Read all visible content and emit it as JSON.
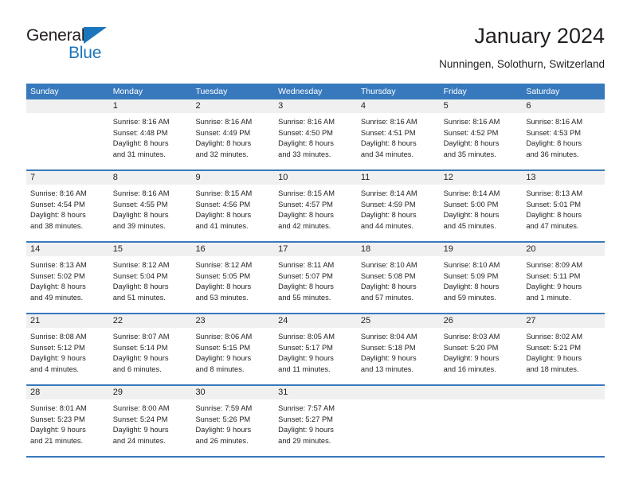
{
  "brand": {
    "name_part1": "General",
    "name_part2": "Blue",
    "triangle_color": "#1b75bb"
  },
  "header": {
    "title": "January 2024",
    "subtitle": "Nunningen, Solothurn, Switzerland"
  },
  "theme": {
    "header_blue": "#3879bd",
    "day_band_gray": "#f0f0f0",
    "text_color": "#231f20"
  },
  "weekdays": [
    "Sunday",
    "Monday",
    "Tuesday",
    "Wednesday",
    "Thursday",
    "Friday",
    "Saturday"
  ],
  "weeks": [
    [
      {
        "day": "",
        "lines": []
      },
      {
        "day": "1",
        "lines": [
          "Sunrise: 8:16 AM",
          "Sunset: 4:48 PM",
          "Daylight: 8 hours",
          "and 31 minutes."
        ]
      },
      {
        "day": "2",
        "lines": [
          "Sunrise: 8:16 AM",
          "Sunset: 4:49 PM",
          "Daylight: 8 hours",
          "and 32 minutes."
        ]
      },
      {
        "day": "3",
        "lines": [
          "Sunrise: 8:16 AM",
          "Sunset: 4:50 PM",
          "Daylight: 8 hours",
          "and 33 minutes."
        ]
      },
      {
        "day": "4",
        "lines": [
          "Sunrise: 8:16 AM",
          "Sunset: 4:51 PM",
          "Daylight: 8 hours",
          "and 34 minutes."
        ]
      },
      {
        "day": "5",
        "lines": [
          "Sunrise: 8:16 AM",
          "Sunset: 4:52 PM",
          "Daylight: 8 hours",
          "and 35 minutes."
        ]
      },
      {
        "day": "6",
        "lines": [
          "Sunrise: 8:16 AM",
          "Sunset: 4:53 PM",
          "Daylight: 8 hours",
          "and 36 minutes."
        ]
      }
    ],
    [
      {
        "day": "7",
        "lines": [
          "Sunrise: 8:16 AM",
          "Sunset: 4:54 PM",
          "Daylight: 8 hours",
          "and 38 minutes."
        ]
      },
      {
        "day": "8",
        "lines": [
          "Sunrise: 8:16 AM",
          "Sunset: 4:55 PM",
          "Daylight: 8 hours",
          "and 39 minutes."
        ]
      },
      {
        "day": "9",
        "lines": [
          "Sunrise: 8:15 AM",
          "Sunset: 4:56 PM",
          "Daylight: 8 hours",
          "and 41 minutes."
        ]
      },
      {
        "day": "10",
        "lines": [
          "Sunrise: 8:15 AM",
          "Sunset: 4:57 PM",
          "Daylight: 8 hours",
          "and 42 minutes."
        ]
      },
      {
        "day": "11",
        "lines": [
          "Sunrise: 8:14 AM",
          "Sunset: 4:59 PM",
          "Daylight: 8 hours",
          "and 44 minutes."
        ]
      },
      {
        "day": "12",
        "lines": [
          "Sunrise: 8:14 AM",
          "Sunset: 5:00 PM",
          "Daylight: 8 hours",
          "and 45 minutes."
        ]
      },
      {
        "day": "13",
        "lines": [
          "Sunrise: 8:13 AM",
          "Sunset: 5:01 PM",
          "Daylight: 8 hours",
          "and 47 minutes."
        ]
      }
    ],
    [
      {
        "day": "14",
        "lines": [
          "Sunrise: 8:13 AM",
          "Sunset: 5:02 PM",
          "Daylight: 8 hours",
          "and 49 minutes."
        ]
      },
      {
        "day": "15",
        "lines": [
          "Sunrise: 8:12 AM",
          "Sunset: 5:04 PM",
          "Daylight: 8 hours",
          "and 51 minutes."
        ]
      },
      {
        "day": "16",
        "lines": [
          "Sunrise: 8:12 AM",
          "Sunset: 5:05 PM",
          "Daylight: 8 hours",
          "and 53 minutes."
        ]
      },
      {
        "day": "17",
        "lines": [
          "Sunrise: 8:11 AM",
          "Sunset: 5:07 PM",
          "Daylight: 8 hours",
          "and 55 minutes."
        ]
      },
      {
        "day": "18",
        "lines": [
          "Sunrise: 8:10 AM",
          "Sunset: 5:08 PM",
          "Daylight: 8 hours",
          "and 57 minutes."
        ]
      },
      {
        "day": "19",
        "lines": [
          "Sunrise: 8:10 AM",
          "Sunset: 5:09 PM",
          "Daylight: 8 hours",
          "and 59 minutes."
        ]
      },
      {
        "day": "20",
        "lines": [
          "Sunrise: 8:09 AM",
          "Sunset: 5:11 PM",
          "Daylight: 9 hours",
          "and 1 minute."
        ]
      }
    ],
    [
      {
        "day": "21",
        "lines": [
          "Sunrise: 8:08 AM",
          "Sunset: 5:12 PM",
          "Daylight: 9 hours",
          "and 4 minutes."
        ]
      },
      {
        "day": "22",
        "lines": [
          "Sunrise: 8:07 AM",
          "Sunset: 5:14 PM",
          "Daylight: 9 hours",
          "and 6 minutes."
        ]
      },
      {
        "day": "23",
        "lines": [
          "Sunrise: 8:06 AM",
          "Sunset: 5:15 PM",
          "Daylight: 9 hours",
          "and 8 minutes."
        ]
      },
      {
        "day": "24",
        "lines": [
          "Sunrise: 8:05 AM",
          "Sunset: 5:17 PM",
          "Daylight: 9 hours",
          "and 11 minutes."
        ]
      },
      {
        "day": "25",
        "lines": [
          "Sunrise: 8:04 AM",
          "Sunset: 5:18 PM",
          "Daylight: 9 hours",
          "and 13 minutes."
        ]
      },
      {
        "day": "26",
        "lines": [
          "Sunrise: 8:03 AM",
          "Sunset: 5:20 PM",
          "Daylight: 9 hours",
          "and 16 minutes."
        ]
      },
      {
        "day": "27",
        "lines": [
          "Sunrise: 8:02 AM",
          "Sunset: 5:21 PM",
          "Daylight: 9 hours",
          "and 18 minutes."
        ]
      }
    ],
    [
      {
        "day": "28",
        "lines": [
          "Sunrise: 8:01 AM",
          "Sunset: 5:23 PM",
          "Daylight: 9 hours",
          "and 21 minutes."
        ]
      },
      {
        "day": "29",
        "lines": [
          "Sunrise: 8:00 AM",
          "Sunset: 5:24 PM",
          "Daylight: 9 hours",
          "and 24 minutes."
        ]
      },
      {
        "day": "30",
        "lines": [
          "Sunrise: 7:59 AM",
          "Sunset: 5:26 PM",
          "Daylight: 9 hours",
          "and 26 minutes."
        ]
      },
      {
        "day": "31",
        "lines": [
          "Sunrise: 7:57 AM",
          "Sunset: 5:27 PM",
          "Daylight: 9 hours",
          "and 29 minutes."
        ]
      },
      {
        "day": "",
        "lines": []
      },
      {
        "day": "",
        "lines": []
      },
      {
        "day": "",
        "lines": []
      }
    ]
  ]
}
